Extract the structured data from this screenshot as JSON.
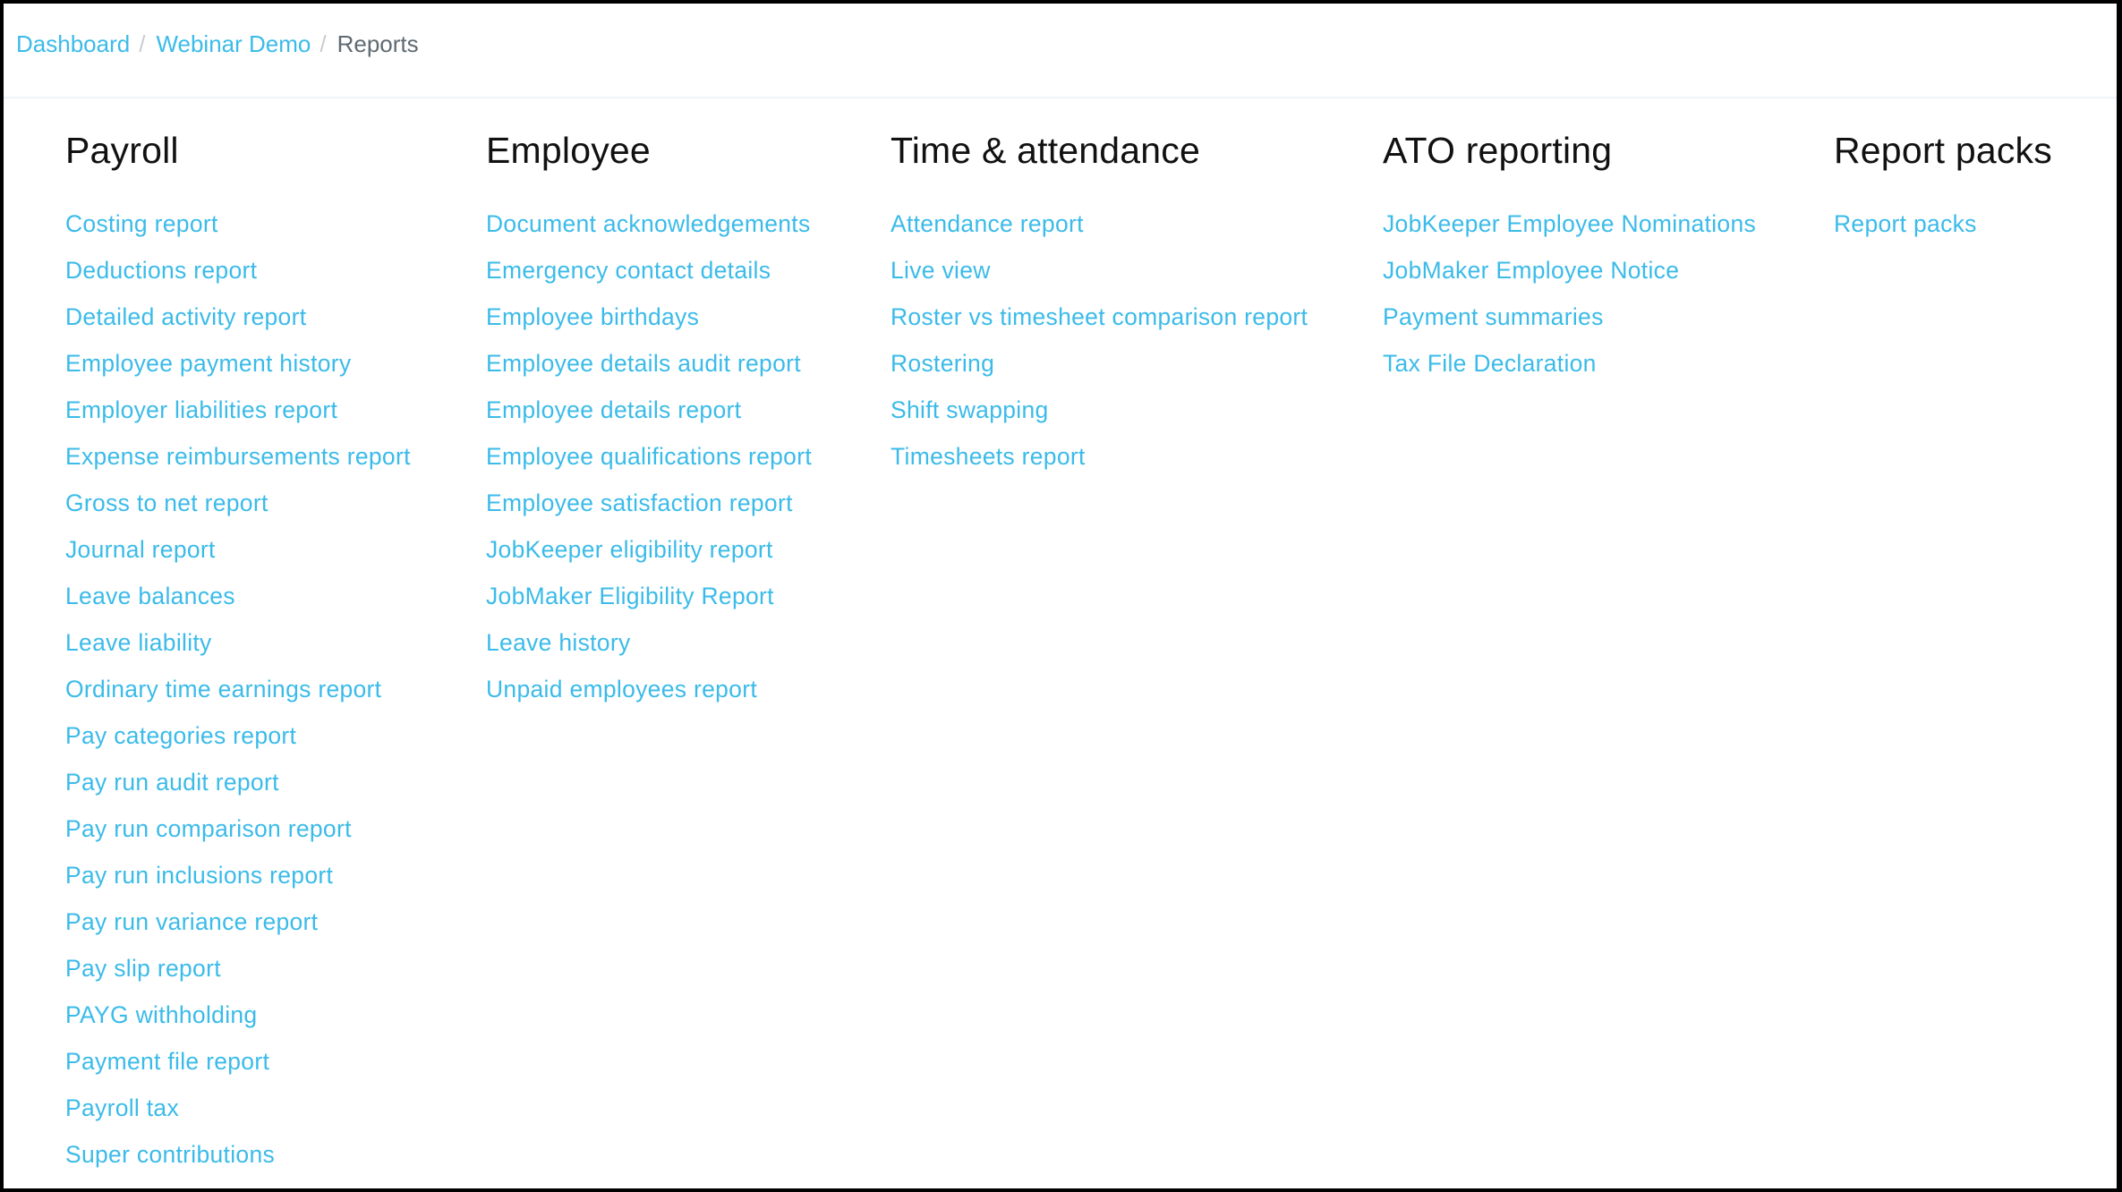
{
  "breadcrumb": {
    "items": [
      {
        "label": "Dashboard",
        "link": true
      },
      {
        "label": "Webinar Demo",
        "link": true
      },
      {
        "label": "Reports",
        "link": false
      }
    ],
    "separator": "/"
  },
  "colors": {
    "link": "#3bbbe9",
    "heading": "#111111",
    "current_crumb": "#5f6a72",
    "divider": "#eef3f7"
  },
  "sections": [
    {
      "title": "Payroll",
      "items": [
        "Costing report",
        "Deductions report",
        "Detailed activity report",
        "Employee payment history",
        "Employer liabilities report",
        "Expense reimbursements report",
        "Gross to net report",
        "Journal report",
        "Leave balances",
        "Leave liability",
        "Ordinary time earnings report",
        "Pay categories report",
        "Pay run audit report",
        "Pay run comparison report",
        "Pay run inclusions report",
        "Pay run variance report",
        "Pay slip report",
        "PAYG withholding",
        "Payment file report",
        "Payroll tax",
        "Super contributions"
      ]
    },
    {
      "title": "Employee",
      "items": [
        "Document acknowledgements",
        "Emergency contact details",
        "Employee birthdays",
        "Employee details audit report",
        "Employee details report",
        "Employee qualifications report",
        "Employee satisfaction report",
        "JobKeeper eligibility report",
        "JobMaker Eligibility Report",
        "Leave history",
        "Unpaid employees report"
      ]
    },
    {
      "title": "Time & attendance",
      "items": [
        "Attendance report",
        "Live view",
        "Roster vs timesheet comparison report",
        "Rostering",
        "Shift swapping",
        "Timesheets report"
      ]
    },
    {
      "title": "ATO reporting",
      "items": [
        "JobKeeper Employee Nominations",
        "JobMaker Employee Notice",
        "Payment summaries",
        "Tax File Declaration"
      ]
    },
    {
      "title": "Report packs",
      "items": [
        "Report packs"
      ]
    }
  ]
}
